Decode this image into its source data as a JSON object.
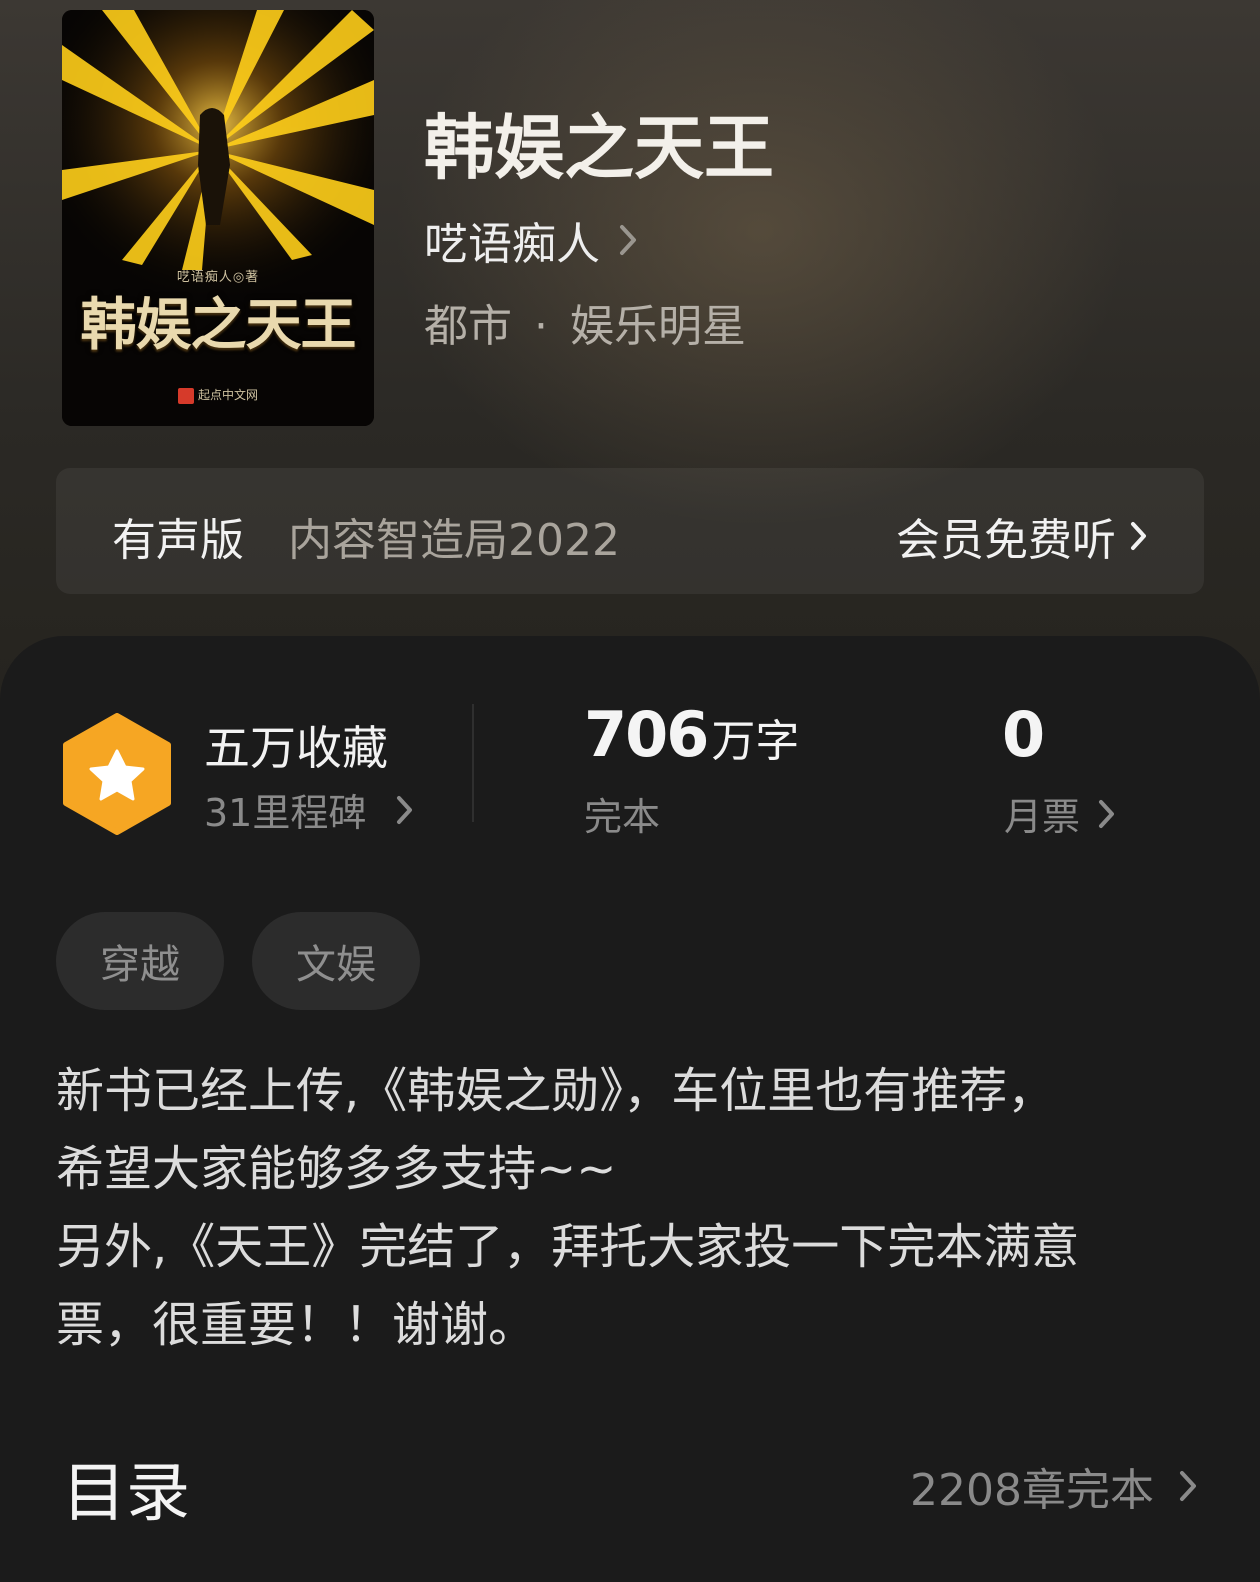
{
  "book": {
    "title": "韩娱之天王",
    "author": "呓语痴人",
    "genre": "都市",
    "subgenre": "娱乐明星",
    "genre_separator": "·",
    "cover": {
      "author_line": "呓语痴人◎著",
      "title": "韩娱之天王",
      "publisher": "起点中文网"
    }
  },
  "audio": {
    "label": "有声版",
    "narrator": "内容智造局2022",
    "cta": "会员免费听"
  },
  "stats": {
    "favorites_title": "五万收藏",
    "milestones": "31里程碑",
    "word_count": "706",
    "word_unit": "万字",
    "status": "完本",
    "monthly_votes": "0",
    "monthly_votes_label": "月票"
  },
  "tags": [
    "穿越",
    "文娱"
  ],
  "description": [
    "新书已经上传,《韩娱之勋》，车位里也有推荐，",
    "希望大家能够多多支持~~",
    "另外,《天王》完结了，拜托大家投一下完本满意",
    "票，很重要！！谢谢。"
  ],
  "toc": {
    "title": "目录",
    "meta": "2208章完本"
  },
  "colors": {
    "badge": "#f6a623",
    "background": "#1b1b1b",
    "tag_bg": "#2c2c2c"
  }
}
